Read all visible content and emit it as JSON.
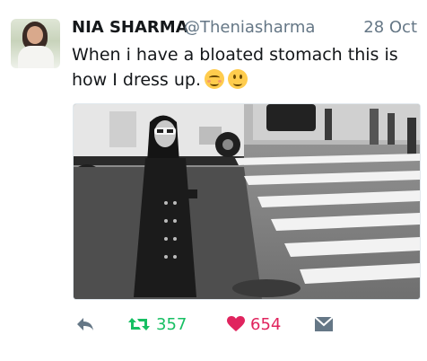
{
  "author": {
    "name": "NIA SHARMA",
    "handle": "@Theniasharma",
    "date": "28 Oct"
  },
  "tweet": {
    "line1": "When i have a bloated stomach this is",
    "line2": "how I dress up.",
    "emojis": [
      "relieved-face-emoji",
      "slightly-smiling-face-emoji"
    ]
  },
  "media": {
    "description_icon": "photo"
  },
  "actions": {
    "retweet_count": "357",
    "like_count": "654"
  },
  "colors": {
    "retweet": "#17bf63",
    "like": "#e0245e",
    "muted": "#657786"
  }
}
